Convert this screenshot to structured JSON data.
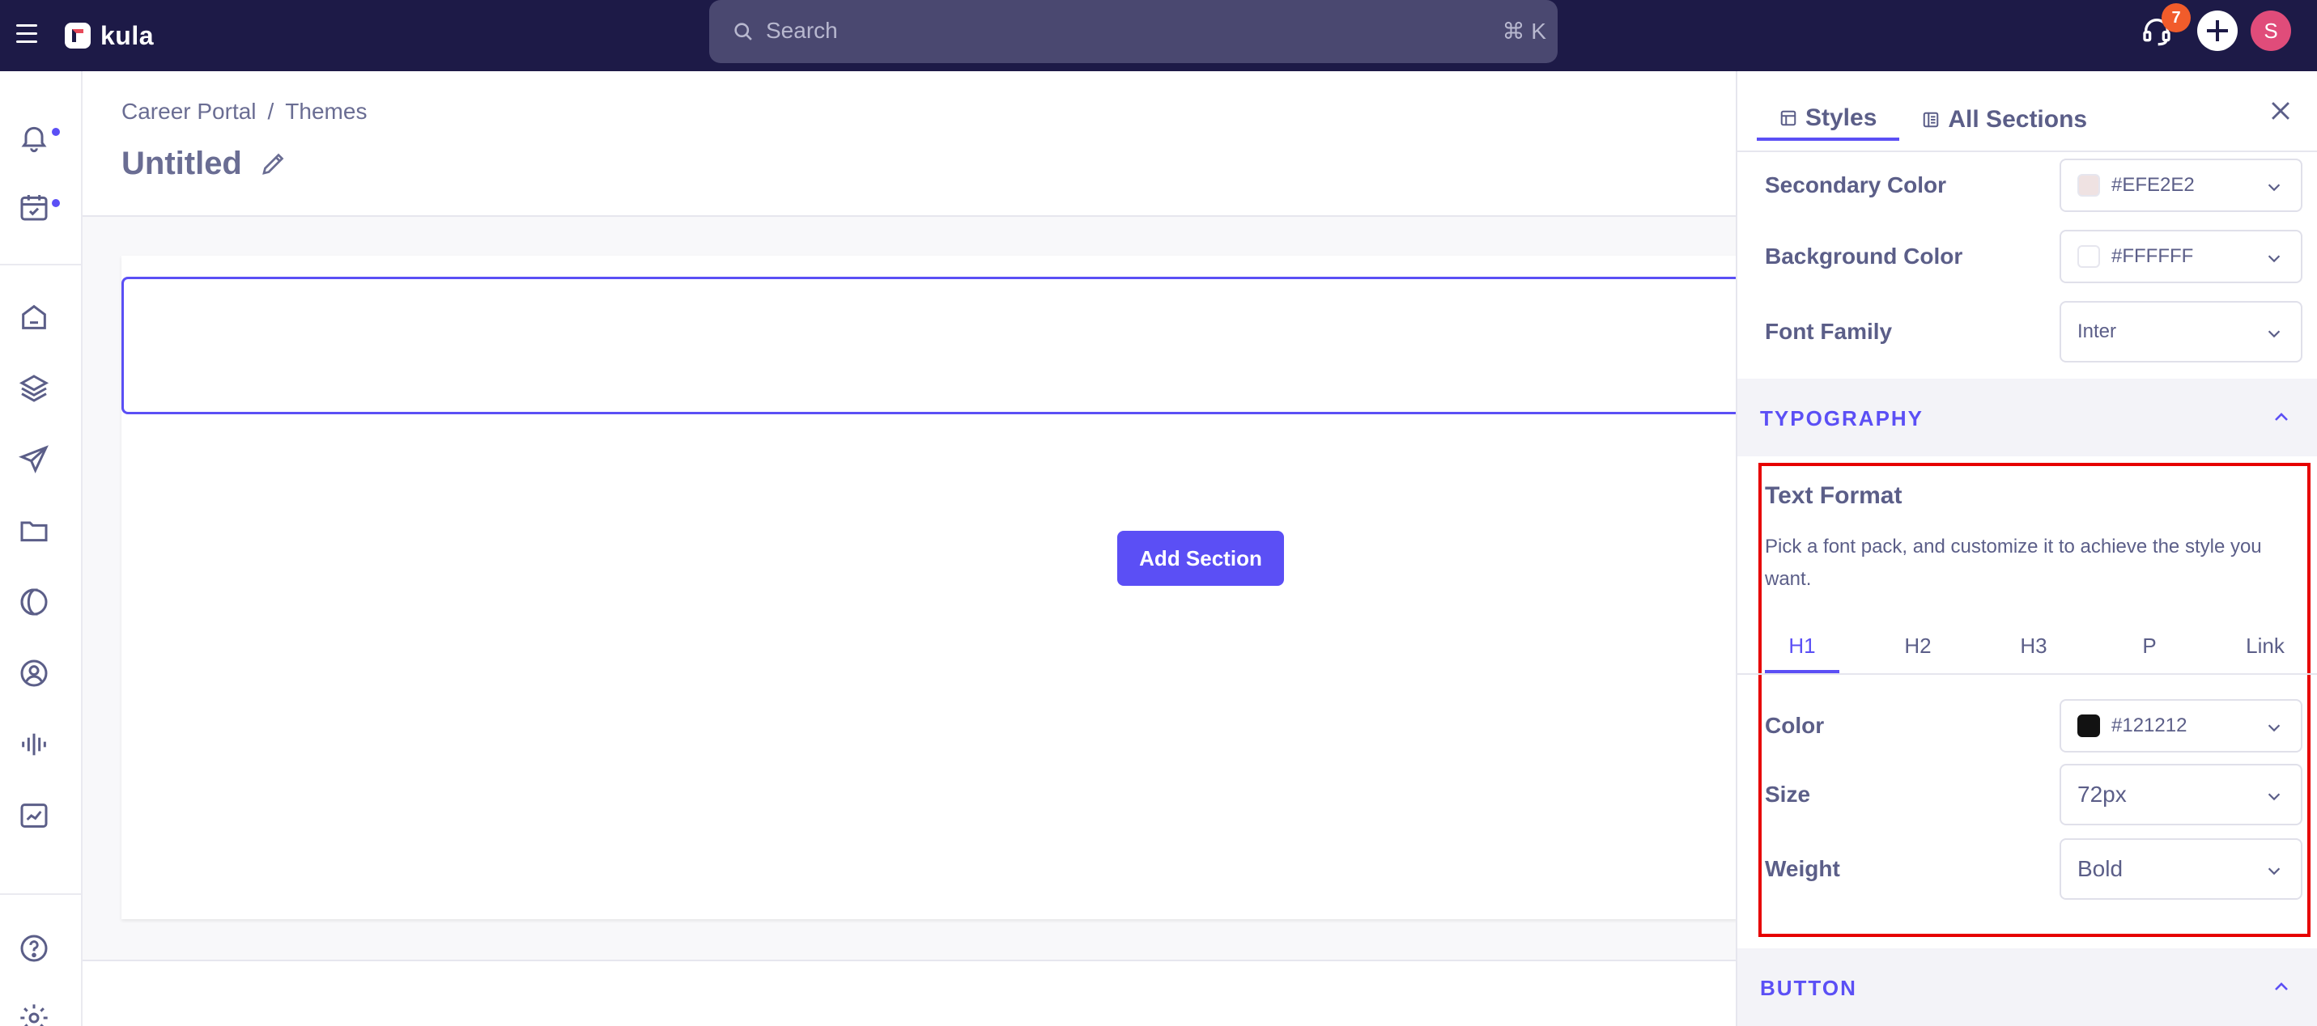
{
  "topbar": {
    "brand": "kula",
    "search_placeholder": "Search",
    "search_shortcut": "⌘ K",
    "notification_count": "7",
    "avatar_initial": "S"
  },
  "breadcrumb": {
    "items": [
      "Career Portal",
      "/",
      "Themes"
    ]
  },
  "page": {
    "title": "Untitled"
  },
  "canvas": {
    "add_section_label": "Add Section"
  },
  "panel": {
    "tabs": [
      "Styles",
      "All Sections"
    ],
    "rows": {
      "secondary_color": {
        "label": "Secondary Color",
        "value": "#EFE2E2",
        "swatch": "#EFE2E2"
      },
      "background_color": {
        "label": "Background Color",
        "value": "#FFFFFF",
        "swatch": "#FFFFFF"
      },
      "font_family": {
        "label": "Font Family",
        "value": "Inter"
      }
    },
    "typography": {
      "band_title": "TYPOGRAPHY",
      "text_format_title": "Text Format",
      "text_format_desc": "Pick a font pack, and customize it to achieve the style you want.",
      "heading_tabs": [
        "H1",
        "H2",
        "H3",
        "P",
        "Link"
      ],
      "color": {
        "label": "Color",
        "value": "#121212",
        "swatch": "#121212"
      },
      "size": {
        "label": "Size",
        "value": "72px"
      },
      "weight": {
        "label": "Weight",
        "value": "Bold"
      }
    },
    "button_band_title": "BUTTON"
  },
  "colors": {
    "accent": "#5b4ff5",
    "topbar": "#1d1a47",
    "highlight": "#e60000"
  }
}
